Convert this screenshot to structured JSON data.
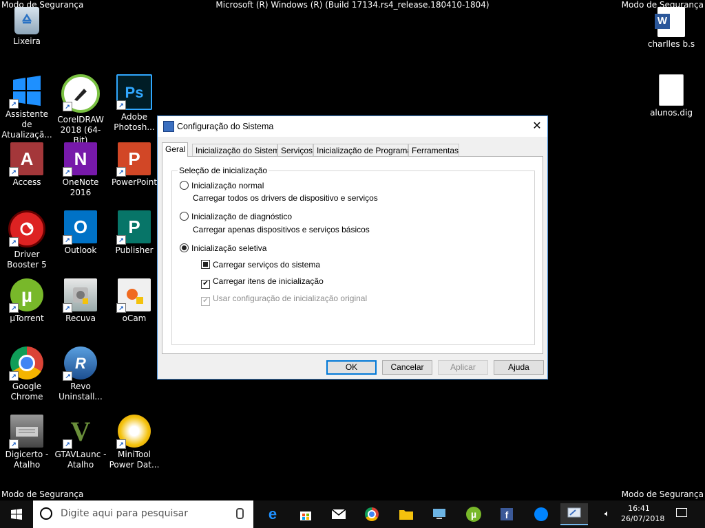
{
  "watermark": {
    "safe_mode": "Modo de Segurança",
    "build": "Microsoft (R) Windows (R) (Build 17134.rs4_release.180410-1804)"
  },
  "desktop_icons": [
    {
      "label": "Lixeira",
      "icon": "recycle-bin-icon"
    },
    {
      "label": "Assistente de Atualizaçã...",
      "icon": "windows-logo-icon"
    },
    {
      "label": "CorelDRAW 2018 (64-Bit)",
      "icon": "coreldraw-icon"
    },
    {
      "label": "Adobe Photosh...",
      "icon": "photoshop-icon",
      "glyph": "Ps"
    },
    {
      "label": "Access",
      "icon": "access-icon",
      "glyph": "A"
    },
    {
      "label": "OneNote 2016",
      "icon": "onenote-icon",
      "glyph": "N"
    },
    {
      "label": "PowerPoint",
      "icon": "powerpoint-icon",
      "glyph": "P"
    },
    {
      "label": "Driver Booster 5",
      "icon": "driver-booster-icon"
    },
    {
      "label": "Outlook",
      "icon": "outlook-icon",
      "glyph": "O"
    },
    {
      "label": "Publisher",
      "icon": "publisher-icon",
      "glyph": "P"
    },
    {
      "label": "µTorrent",
      "icon": "utorrent-icon",
      "glyph": "µ"
    },
    {
      "label": "Recuva",
      "icon": "recuva-icon"
    },
    {
      "label": "oCam",
      "icon": "ocam-icon"
    },
    {
      "label": "Google Chrome",
      "icon": "chrome-icon"
    },
    {
      "label": "Revo Uninstall...",
      "icon": "revo-uninstaller-icon",
      "glyph": "R"
    },
    {
      "label": "Digicerto - Atalho",
      "icon": "digicerto-icon"
    },
    {
      "label": "GTAVLaunc - Atalho",
      "icon": "gta-v-icon",
      "glyph": "V"
    },
    {
      "label": "MiniTool Power Dat...",
      "icon": "minitool-icon"
    },
    {
      "label": "charlles b.s",
      "icon": "word-document-icon",
      "glyph": "W"
    },
    {
      "label": "alunos.dig",
      "icon": "blank-file-icon"
    }
  ],
  "dialog": {
    "title": "Configuração do Sistema",
    "close_glyph": "✕",
    "tabs": [
      "Geral",
      "Inicialização do Sistema",
      "Serviços",
      "Inicialização de Programas",
      "Ferramentas"
    ],
    "active_tab": "Geral",
    "group_label": "Seleção de inicialização",
    "options": {
      "normal": "Inicialização normal",
      "normal_desc": "Carregar todos os drivers de dispositivo e serviços",
      "diagnostic": "Inicialização de diagnóstico",
      "diagnostic_desc": "Carregar apenas dispositivos e serviços básicos",
      "selective": "Inicialização seletiva",
      "selected": "selective"
    },
    "checkboxes": {
      "system_services": "Carregar serviços do sistema",
      "startup_items": "Carregar itens de inicialização",
      "original_config": "Usar configuração de inicialização original"
    },
    "buttons": {
      "ok": "OK",
      "cancel": "Cancelar",
      "apply": "Aplicar",
      "help": "Ajuda"
    }
  },
  "taskbar": {
    "search_placeholder": "Digite aqui para pesquisar",
    "apps": [
      "edge-icon",
      "store-icon",
      "mail-icon",
      "chrome-icon",
      "file-explorer-icon",
      "remote-desktop-icon",
      "utorrent-icon",
      "facebook-icon",
      "messenger-icon",
      "system-config-icon"
    ],
    "time": "16:41",
    "date": "26/07/2018"
  },
  "colors": {
    "accent": "#0078d7",
    "dialog_border": "#4a90d9"
  }
}
